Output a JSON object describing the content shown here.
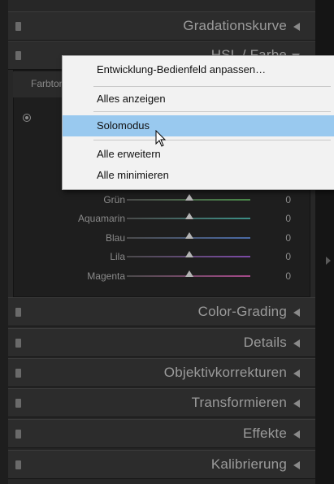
{
  "panels": [
    {
      "title": "Gradationskurve"
    },
    {
      "title": "HSL / Farbe"
    },
    {
      "title": "Color-Grading"
    },
    {
      "title": "Details"
    },
    {
      "title": "Objektivkorrekturen"
    },
    {
      "title": "Transformieren"
    },
    {
      "title": "Effekte"
    },
    {
      "title": "Kalibrierung"
    }
  ],
  "hsl": {
    "tab_label": "Farbton",
    "sliders": [
      {
        "label": "Grün",
        "value": "0",
        "track_color": "#4a8a4a"
      },
      {
        "label": "Aquamarin",
        "value": "0",
        "track_color": "#3c8f86"
      },
      {
        "label": "Blau",
        "value": "0",
        "track_color": "#4a6aa6"
      },
      {
        "label": "Lila",
        "value": "0",
        "track_color": "#7b4aa6"
      },
      {
        "label": "Magenta",
        "value": "0",
        "track_color": "#a64a8a"
      }
    ]
  },
  "context_menu": {
    "items": [
      {
        "label": "Entwicklung-Bedienfeld anpassen…"
      },
      {
        "label": "Alles anzeigen"
      },
      {
        "label": "Solomodus",
        "highlighted": true
      },
      {
        "label": "Alle erweitern"
      },
      {
        "label": "Alle minimieren"
      }
    ],
    "highlight_color": "#99c9ef"
  }
}
